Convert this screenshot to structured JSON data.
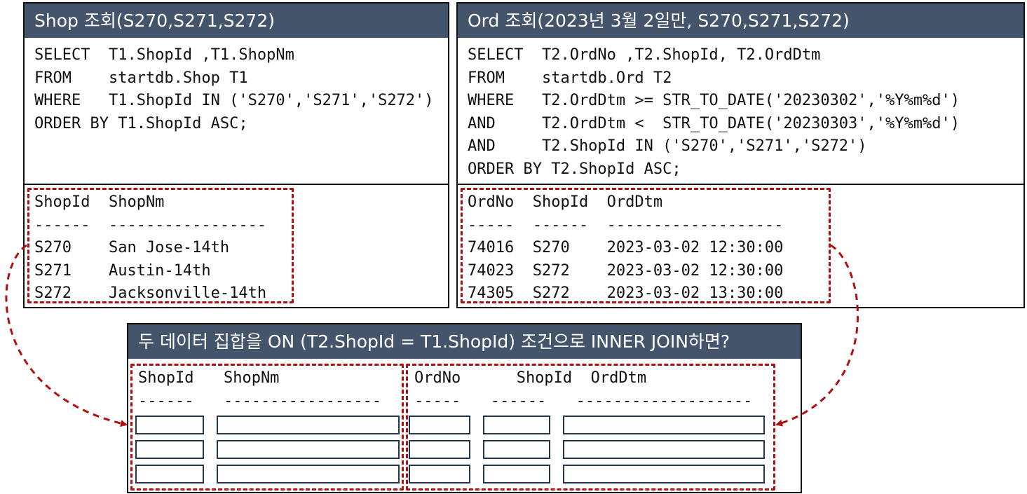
{
  "shop_panel": {
    "title": "Shop 조회(S270,S271,S272)",
    "sql": "SELECT  T1.ShopId ,T1.ShopNm\nFROM    startdb.Shop T1\nWHERE   T1.ShopId IN ('S270','S271','S272')\nORDER BY T1.ShopId ASC;",
    "result": "ShopId  ShopNm\n------  -----------------\nS270    San Jose-14th\nS271    Austin-14th\nS272    Jacksonville-14th"
  },
  "ord_panel": {
    "title": "Ord 조회(2023년 3월 2일만, S270,S271,S272)",
    "sql": "SELECT  T2.OrdNo ,T2.ShopId, T2.OrdDtm\nFROM    startdb.Ord T2\nWHERE   T2.OrdDtm >= STR_TO_DATE('20230302','%Y%m%d')\nAND     T2.OrdDtm <  STR_TO_DATE('20230303','%Y%m%d')\nAND     T2.ShopId IN ('S270','S271','S272')\nORDER BY T2.ShopId ASC;",
    "result": "OrdNo  ShopId  OrdDtm\n-----  ------  -------------------\n74016  S270    2023-03-02 12:30:00\n74023  S272    2023-03-02 12:30:00\n74305  S272    2023-03-02 13:30:00"
  },
  "join_panel": {
    "title": "두 데이터 집합을 ON (T2.ShopId = T1.ShopId) 조건으로 INNER JOIN하면?",
    "left_header": "ShopId  ShopNm",
    "left_rule": "------  -----------------",
    "right_header": "OrdNo      ShopId  OrdDtm",
    "right_rule": "-----  ------  -------------------"
  },
  "colors": {
    "header_bg": "#44546a",
    "accent_red": "#b01010",
    "cell_border": "#22364f"
  }
}
